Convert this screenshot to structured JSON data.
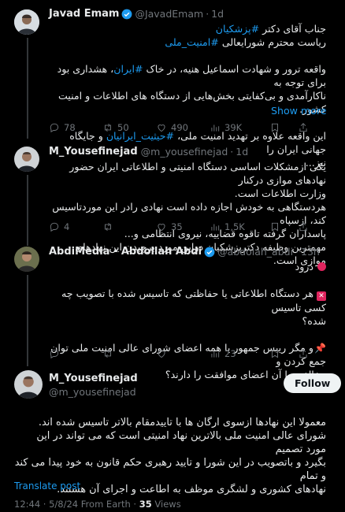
{
  "tweets": [
    {
      "name": "Javad Emam",
      "handle": "@JavadEmam",
      "sep": "·",
      "time": "1d",
      "line1_a": "جناب آقای دکتر ",
      "line1_tag": "#پزشکیان",
      "line2_a": "ریاست محترم شورایعالی ",
      "line2_tag": "#امنیت_ملی",
      "p2_l1_a": "واقعه ترور و شهادت اسماعیل هنیه، در خاک ",
      "p2_l1_tag": "#ایران",
      "p2_l1_b": "، هشداری بود برای توجه به",
      "p2_l2": "ناکارآمدی و بی‌کفایتی بخش‌هایی از دستگاه های اطلاعات و امنیت کشور.",
      "p3_l1_a": "این واقعه علاوه بر تهدید امنیت ملی، ",
      "p3_l1_tag": "#حیثیت_ایرانیان",
      "p3_l1_b": " و جایگاه جهانی ایران را",
      "p3_l2": "نیز...",
      "show_more": "Show more",
      "stats": {
        "replies": "78",
        "reposts": "50",
        "likes": "490",
        "views": "39K"
      }
    },
    {
      "name": "M_Yousefinejad",
      "handle": "@m_yousefinejad",
      "sep": "·",
      "time": "1d",
      "lines": [
        "یکی ازمشکلات اساسی دستگاه امنیتی و اطلاعاتی ایران حضور نهادهای موازی درکنار",
        "وزارت اطلاعات است.",
        "هردستگاهی به خودش اجازه داده است نهادی رادر این موردتاسیس کند، ازسپاه",
        "پاسداران گرفته تاقوه قضاییه، نیروی انتظامی و...",
        "مهمترین وظیفه دکترپزشکیان دراین مورد برچیدن این نهادهای موازی است."
      ],
      "stats": {
        "replies": "4",
        "reposts": "",
        "likes": "35",
        "views": "1,5K"
      }
    },
    {
      "name": "AbdiMedia - Abdollah Abdi",
      "handle": "@abdolah_abdi",
      "sep": "·",
      "time": "13h",
      "greeting": "درود",
      "x_emoji": "✕",
      "q1_l1": "هر دستگاه اطلاعاتی یا حفاظتی که تاسیس شده با تصویب چه کسی تاسیس",
      "q1_l2": "شده؟",
      "pin_emoji": "📌",
      "q2_l1": "و مگر رییس جمهور یا همه اعضای شورای عالی امنیت ملی توان جمع کردن و",
      "q2_l2": "مخالفت با آن اعضای موافقت را دارند؟",
      "stats": {
        "replies": "",
        "reposts": "",
        "likes": "",
        "views": "23"
      }
    },
    {
      "name": "M_Yousefinejad",
      "handle": "@m_yousefinejad",
      "follow_label": "Follow",
      "lines": [
        "معمولا این نهادها ازسوی ارگان ها با تاییدمقام بالاتر تاسیس شده اند.",
        "شورای عالی امنیت ملی بالاترین نهاد امنیتی است که می تواند در این مورد تصمیم",
        "بگیرد و باتصویب در این شورا و تایید رهبری حکم قانون به خود پیدا می کند و تمام",
        "نهادهای کشوری و لشگری موظف به اطاعت و اجرای آن هستند."
      ],
      "translate": "Translate post",
      "meta_time": "12:44 · 5/8/24 From Earth ·",
      "meta_views_count": "35",
      "meta_views_label": "Views"
    }
  ],
  "colors": {
    "accent": "#1d9bf0",
    "background": "#000000",
    "text": "#e7e9ea",
    "muted": "#71767b"
  },
  "icons": [
    "verified-badge-icon",
    "reply-icon",
    "repost-icon",
    "like-icon",
    "views-icon",
    "bookmark-icon",
    "share-icon"
  ]
}
